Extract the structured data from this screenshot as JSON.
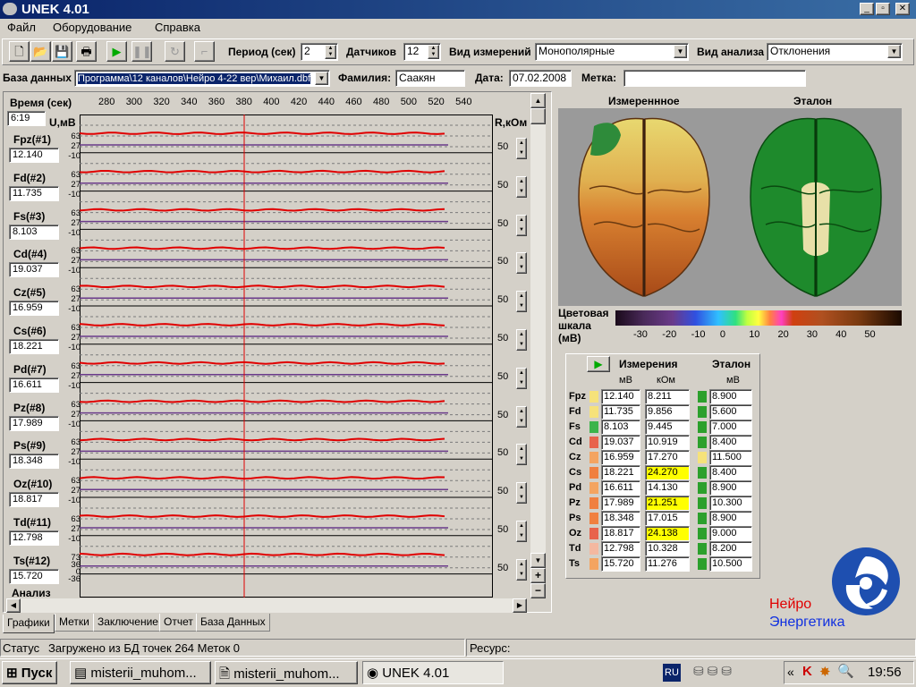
{
  "window": {
    "title": "UNEK 4.01"
  },
  "menu": [
    "Файл",
    "Оборудование",
    "Справка"
  ],
  "toolbar": {
    "period_label": "Период (сек)",
    "period_value": "2",
    "sensors_label": "Датчиков",
    "sensors_value": "12",
    "measure_type_label": "Вид измерений",
    "measure_type_value": "Монополярные",
    "analysis_label": "Вид анализа",
    "analysis_value": "Отклонения"
  },
  "infobar": {
    "db_label": "База данных",
    "db_value": "Программа\\12 каналов\\Нейро 4-22 вер\\Михаил.dbf",
    "surname_label": "Фамилия:",
    "surname_value": "Саакян",
    "date_label": "Дата:",
    "date_value": "07.02.2008",
    "mark_label": "Метка:",
    "mark_value": ""
  },
  "graph": {
    "time_label": "Время (сек)",
    "time_value": "6:19",
    "umv_label": "U,мВ",
    "rkom_label": "R,кОм",
    "analysis_label": "Анализ",
    "ticks": [
      "280",
      "300",
      "320",
      "340",
      "360",
      "380",
      "400",
      "420",
      "440",
      "460",
      "480",
      "500",
      "520",
      "540"
    ],
    "channels": [
      {
        "name": "Fpz(#1)",
        "value": "12.140",
        "scale": [
          "63",
          "27",
          "-10"
        ],
        "r": "50"
      },
      {
        "name": "Fd(#2)",
        "value": "11.735",
        "scale": [
          "63",
          "27",
          "-10"
        ],
        "r": "50"
      },
      {
        "name": "Fs(#3)",
        "value": "8.103",
        "scale": [
          "63",
          "27",
          "-10"
        ],
        "r": "50"
      },
      {
        "name": "Cd(#4)",
        "value": "19.037",
        "scale": [
          "63",
          "27",
          "-10"
        ],
        "r": "50"
      },
      {
        "name": "Cz(#5)",
        "value": "16.959",
        "scale": [
          "63",
          "27",
          "-10"
        ],
        "r": "50"
      },
      {
        "name": "Cs(#6)",
        "value": "18.221",
        "scale": [
          "63",
          "27",
          "-10"
        ],
        "r": "50"
      },
      {
        "name": "Pd(#7)",
        "value": "16.611",
        "scale": [
          "63",
          "27",
          "-10"
        ],
        "r": "50"
      },
      {
        "name": "Pz(#8)",
        "value": "17.989",
        "scale": [
          "63",
          "27",
          "-10"
        ],
        "r": "50"
      },
      {
        "name": "Ps(#9)",
        "value": "18.348",
        "scale": [
          "63",
          "27",
          "-10"
        ],
        "r": "50"
      },
      {
        "name": "Oz(#10)",
        "value": "18.817",
        "scale": [
          "63",
          "27",
          "-10"
        ],
        "r": "50"
      },
      {
        "name": "Td(#11)",
        "value": "12.798",
        "scale": [
          "63",
          "27",
          "-10"
        ],
        "r": "50"
      },
      {
        "name": "Ts(#12)",
        "value": "15.720",
        "scale": [
          "73",
          "36",
          "0",
          "-36"
        ],
        "r": "50"
      }
    ]
  },
  "tabs": [
    "Графики",
    "Метки",
    "Заключение",
    "Отчет",
    "База Данных"
  ],
  "brain": {
    "measured_label": "Измереннное",
    "reference_label": "Эталон",
    "scale_label": "Цветовая шкала (мВ)",
    "scale_ticks": [
      "-30",
      "-20",
      "-10",
      "0",
      "10",
      "20",
      "30",
      "40",
      "50"
    ]
  },
  "table": {
    "measurements_label": "Измерения",
    "reference_label": "Эталон",
    "col_mv": "мВ",
    "col_kom": "кОм",
    "col_ref_mv": "мВ",
    "rows": [
      {
        "name": "Fpz",
        "mv": "12.140",
        "kom": "8.211",
        "ref": "8.900",
        "c1": "#f6e27a",
        "c2": "#2ca02c",
        "hl": false
      },
      {
        "name": "Fd",
        "mv": "11.735",
        "kom": "9.856",
        "ref": "5.600",
        "c1": "#f6e27a",
        "c2": "#2ca02c",
        "hl": false
      },
      {
        "name": "Fs",
        "mv": "8.103",
        "kom": "9.445",
        "ref": "7.000",
        "c1": "#3cb44b",
        "c2": "#2ca02c",
        "hl": false
      },
      {
        "name": "Cd",
        "mv": "19.037",
        "kom": "10.919",
        "ref": "8.400",
        "c1": "#e8634c",
        "c2": "#2ca02c",
        "hl": false
      },
      {
        "name": "Cz",
        "mv": "16.959",
        "kom": "17.270",
        "ref": "11.500",
        "c1": "#f4a460",
        "c2": "#f6e27a",
        "hl": false
      },
      {
        "name": "Cs",
        "mv": "18.221",
        "kom": "24.270",
        "ref": "8.400",
        "c1": "#f08040",
        "c2": "#2ca02c",
        "hl": true
      },
      {
        "name": "Pd",
        "mv": "16.611",
        "kom": "14.130",
        "ref": "8.900",
        "c1": "#f4a460",
        "c2": "#2ca02c",
        "hl": false
      },
      {
        "name": "Pz",
        "mv": "17.989",
        "kom": "21.251",
        "ref": "10.300",
        "c1": "#f08040",
        "c2": "#2ca02c",
        "hl": true
      },
      {
        "name": "Ps",
        "mv": "18.348",
        "kom": "17.015",
        "ref": "8.900",
        "c1": "#f08040",
        "c2": "#2ca02c",
        "hl": false
      },
      {
        "name": "Oz",
        "mv": "18.817",
        "kom": "24.138",
        "ref": "9.000",
        "c1": "#e8634c",
        "c2": "#2ca02c",
        "hl": true
      },
      {
        "name": "Td",
        "mv": "12.798",
        "kom": "10.328",
        "ref": "8.200",
        "c1": "#f4b8a0",
        "c2": "#2ca02c",
        "hl": false
      },
      {
        "name": "Ts",
        "mv": "15.720",
        "kom": "11.276",
        "ref": "10.500",
        "c1": "#f4a460",
        "c2": "#2ca02c",
        "hl": false
      }
    ]
  },
  "logo": {
    "line1": "Нейро",
    "line2": "Энергетика"
  },
  "status": {
    "label": "Статус",
    "text": "Загружено из БД точек 264 Меток 0",
    "resource_label": "Ресурс:"
  },
  "taskbar": {
    "start": "Пуск",
    "tasks": [
      "misterii_muhom...",
      "misterii_muhom...",
      "UNEK 4.01"
    ],
    "lang": "RU",
    "time": "19:56"
  },
  "colors": {
    "accent": "#0a246a",
    "highlight": "#ffff00",
    "trace": "#e00000"
  }
}
